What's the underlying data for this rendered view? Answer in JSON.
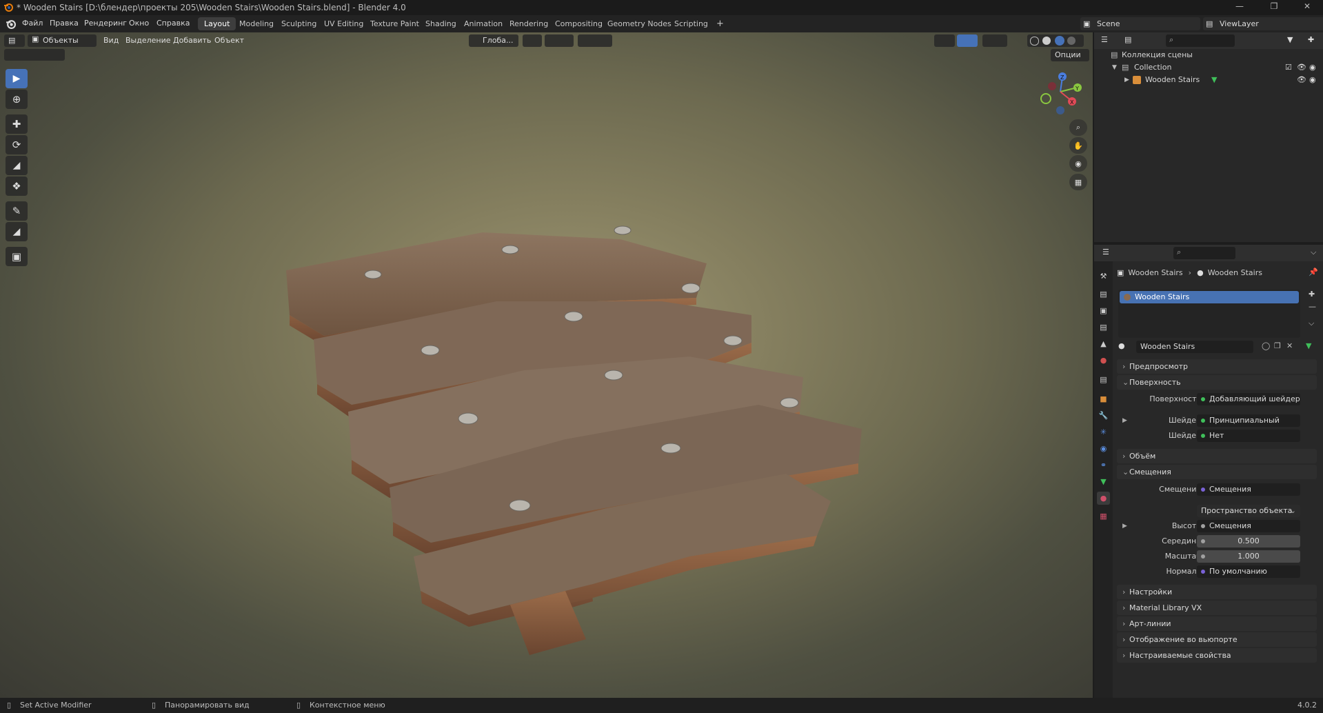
{
  "window": {
    "title": "* Wooden Stairs [D:\\блендер\\проекты 205\\Wooden Stairs\\Wooden Stairs.blend] - Blender 4.0"
  },
  "menu": {
    "items": [
      "Файл",
      "Правка",
      "Рендеринг",
      "Окно",
      "Справка"
    ]
  },
  "workspaces": {
    "tabs": [
      "Layout",
      "Modeling",
      "Sculpting",
      "UV Editing",
      "Texture Paint",
      "Shading",
      "Animation",
      "Rendering",
      "Compositing",
      "Geometry Nodes",
      "Scripting"
    ],
    "active": "Layout",
    "add_label": "+"
  },
  "scene": {
    "name": "Scene",
    "view_layer": "ViewLayer"
  },
  "viewport_header": {
    "mode": "Объекты",
    "menus": [
      "Вид",
      "Выделение",
      "Добавить",
      "Объект"
    ],
    "orientation": "Глоба...",
    "options_label": "Опции"
  },
  "gizmo": {
    "z": "Z",
    "y": "Y",
    "x": "X"
  },
  "outliner": {
    "scene_collection": "Коллекция сцены",
    "collection": "Collection",
    "object": "Wooden Stairs"
  },
  "properties": {
    "breadcrumb": [
      "Wooden Stairs",
      "Wooden Stairs"
    ],
    "material_slot": "Wooden Stairs",
    "material_name": "Wooden Stairs",
    "panels": {
      "preview": "Предпросмотр",
      "surface": "Поверхность",
      "volume": "Объём",
      "displacement": "Смещения",
      "settings": "Настройки",
      "material_library": "Material Library VX",
      "lineart": "Арт-линии",
      "viewport_display": "Отображение во вьюпорте",
      "custom_props": "Настраиваемые свойства"
    },
    "surface_rows": [
      {
        "label": "Поверхность",
        "value": "Добавляющий шейдер",
        "color": "#3fbf5a",
        "expand": false
      },
      {
        "label": "Шейдер",
        "value": "Принципиальный BSDF",
        "color": "#3fbf5a",
        "expand": true
      },
      {
        "label": "Шейдер",
        "value": "Нет",
        "color": "#3fbf5a",
        "expand": false
      }
    ],
    "displacement_rows": [
      {
        "label": "Смещения",
        "value": "Смещения",
        "color": "#7a62d6",
        "expand": false
      },
      {
        "label": "",
        "value": "Пространство объекта",
        "color": "",
        "expand": false
      },
      {
        "label": "Высота",
        "value": "Смещения",
        "color": "#a0a0a0",
        "expand": true
      },
      {
        "label": "Середина",
        "value": "0.500",
        "color": "#a0a0a0",
        "expand": false
      },
      {
        "label": "Масштаб",
        "value": "1.000",
        "color": "#a0a0a0",
        "expand": false
      },
      {
        "label": "Нормаль",
        "value": "По умолчанию",
        "color": "#7a62d6",
        "expand": false
      }
    ]
  },
  "statusbar": {
    "left": "Set Active Modifier",
    "middle": "Панорамировать вид",
    "right": "Контекстное меню",
    "version": "4.0.2"
  },
  "colors": {
    "accent": "#4672b8",
    "selection": "#4772b3",
    "wood": "#8a6a4f",
    "socket_green": "#3fbf5a",
    "socket_purple": "#7a62d6"
  }
}
